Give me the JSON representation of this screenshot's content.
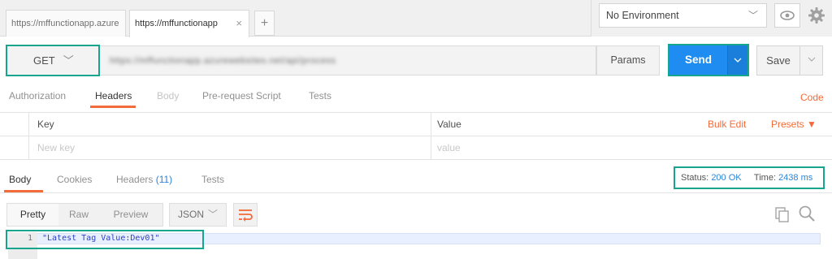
{
  "tabs": [
    {
      "label": "https://mffunctionapp.azure",
      "active": false
    },
    {
      "label": "https://mffunctionapp",
      "active": true,
      "close": "×"
    }
  ],
  "add_tab": "+",
  "environment": {
    "selected": "No Environment",
    "chevron": "﹀",
    "eye_icon": "eye-icon",
    "gear_icon": "gear-icon"
  },
  "request": {
    "method": "GET",
    "method_chevron": "﹀",
    "url": "https://mffunctionapp.azurewebsites.net/api/process",
    "params_label": "Params",
    "send_label": "Send",
    "save_label": "Save"
  },
  "request_tabs": [
    {
      "label": "Authorization",
      "state": "normal"
    },
    {
      "label": "Headers",
      "state": "active"
    },
    {
      "label": "Body",
      "state": "disabled"
    },
    {
      "label": "Pre-request Script",
      "state": "normal"
    },
    {
      "label": "Tests",
      "state": "normal"
    }
  ],
  "code_link": "Code",
  "headers_table": {
    "key_header": "Key",
    "value_header": "Value",
    "bulk_edit": "Bulk Edit",
    "presets": "Presets ▼",
    "key_placeholder": "New key",
    "value_placeholder": "value"
  },
  "response_tabs": [
    {
      "label": "Body",
      "state": "active"
    },
    {
      "label": "Cookies",
      "state": "normal"
    },
    {
      "label": "Headers",
      "count": "(11)",
      "state": "normal"
    },
    {
      "label": "Tests",
      "state": "normal"
    }
  ],
  "status": {
    "status_label": "Status:",
    "status_value": "200 OK",
    "time_label": "Time:",
    "time_value": "2438 ms"
  },
  "view_modes": [
    "Pretty",
    "Raw",
    "Preview"
  ],
  "format_select": {
    "value": "JSON",
    "chevron": "﹀"
  },
  "response_body": {
    "line_number": "1",
    "text": "\"Latest Tag Value:Dev01\""
  },
  "colors": {
    "accent": "#f26b3a",
    "send": "#1e8cf0",
    "highlight_border": "#16a68f",
    "link_blue": "#2a84d8"
  }
}
